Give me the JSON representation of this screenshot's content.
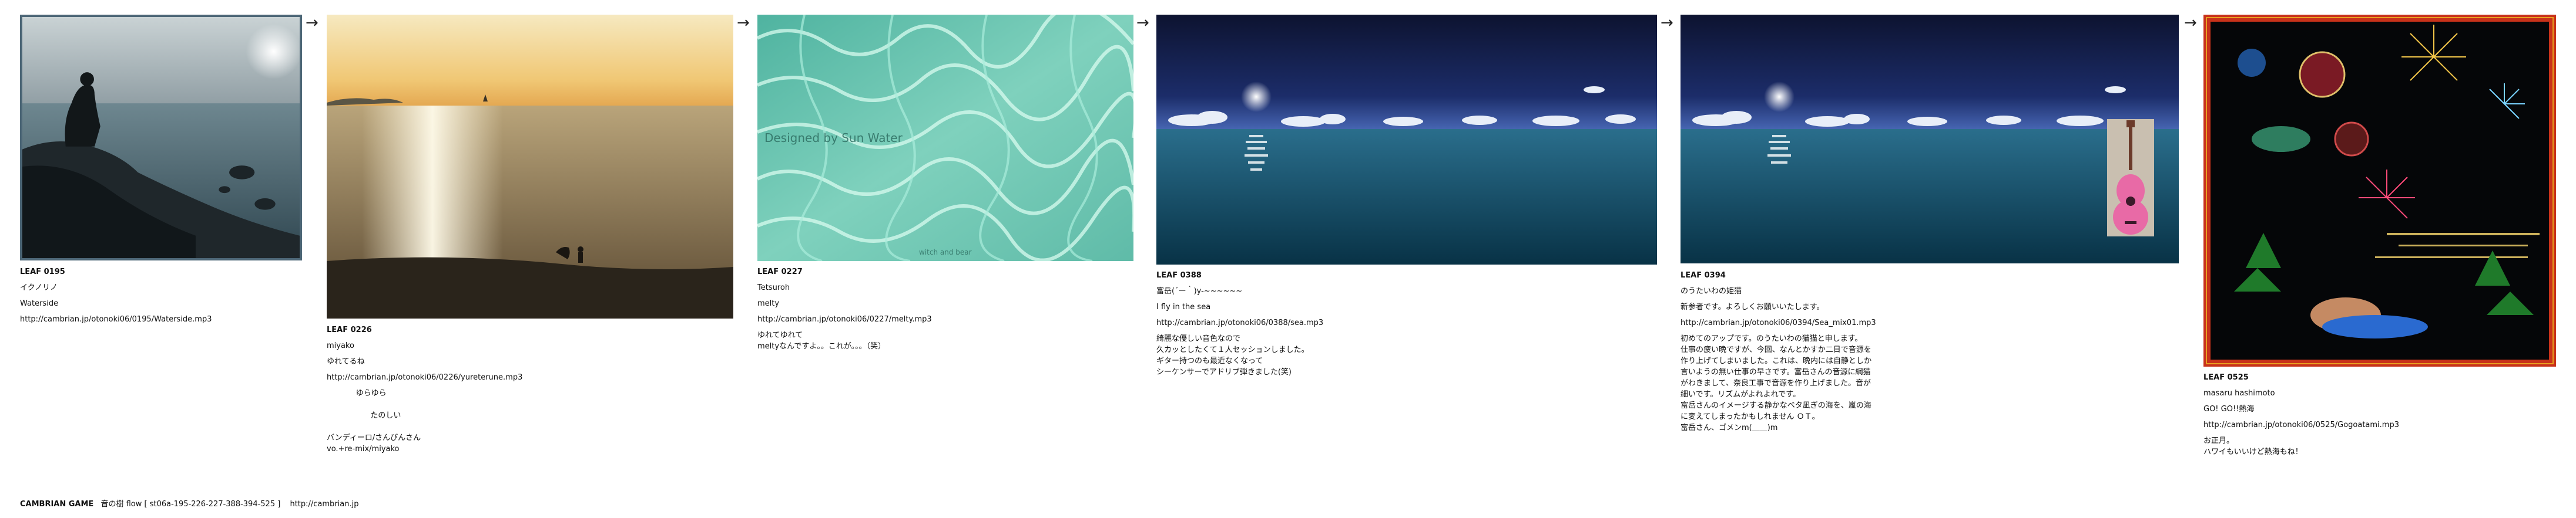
{
  "leaves": [
    {
      "id": "LEAF 0195",
      "title": "イクノリノ",
      "song": "Waterside",
      "url": "http://cambrian.jp/otonoki06/0195/Waterside.mp3",
      "comment": ""
    },
    {
      "id": "LEAF 0226",
      "title": "miyako",
      "song": "ゆれてるね",
      "url": "http://cambrian.jp/otonoki06/0226/yureterune.mp3",
      "comment": "            ゆらゆら\n\n                  たのしい\n\nバンディーロ/さんびんさん\nvo.+re-mix/miyako"
    },
    {
      "id": "LEAF 0227",
      "title": "Tetsuroh",
      "song": "melty",
      "url": "http://cambrian.jp/otonoki06/0227/melty.mp3",
      "comment": "ゆれてゆれて\nmeltyなんですよ。。これが。。。（笑）",
      "watermark": "Designed by Sun Water",
      "caption": "witch and bear"
    },
    {
      "id": "LEAF 0388",
      "title": "富岳(´ー｀)y-~~~~~~",
      "song": "I fly in the sea",
      "url": "http://cambrian.jp/otonoki06/0388/sea.mp3",
      "comment": "綺麗な優しい音色なので\n久カッとしたくて１人セッションしました。\nギター持つのも最近なくなって\nシーケンサーでアドリブ弾きました(笑)"
    },
    {
      "id": "LEAF 0394",
      "title": "のうたいわの姫猫",
      "song": "新参者です。よろしくお願いいたします。",
      "url": "http://cambrian.jp/otonoki06/0394/Sea_mix01.mp3",
      "comment": "初めてのアップです。のうたいわの猫猫と申します。\n仕事の疲い晩ですが、今回、なんとかすか二日で音源を\n作り上げてしまいました。これは、晩内には自静としか\n言いようの無い仕事の早さです。富岳さんの音源に綱猫\nがわきまして、奈良工事で音源を作り上げました。音が\n細いです。リズムがよれよれです。\n富岳さんのイメージする静かなベタ凪ぎの海を、嵐の海\nに変えてしまったかもしれません ＯＴ。\n富岳さん、ゴメンm(＿＿)m"
    },
    {
      "id": "LEAF 0525",
      "title": "masaru hashimoto",
      "song": "GO! GO!!熱海",
      "url": "http://cambrian.jp/otonoki06/0525/Gogoatami.mp3",
      "comment": "お正月。\nハワイもいいけど熱海もね！"
    }
  ],
  "arrow_glyph": "→",
  "footer": {
    "brand": "CAMBRIAN GAME",
    "flow": "音の樹  flow [ st06a-195-226-227-388-394-525 ]",
    "link": "http://cambrian.jp"
  },
  "colors": {
    "background": "#ffffff",
    "text": "#111111",
    "frame_red": "#c8321a"
  },
  "icons": [
    "right-arrow-icon"
  ]
}
